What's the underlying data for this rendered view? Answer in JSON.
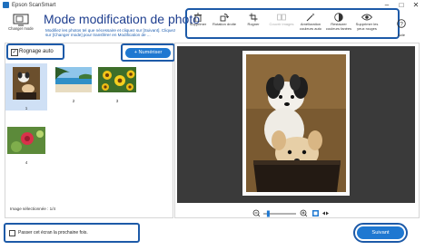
{
  "app": {
    "title": "Epson ScanSmart",
    "accent": "#1f78d1",
    "highlight": "#1d5aa8"
  },
  "header": {
    "changer_mode": "Changer mode",
    "title": "Mode modification de photo",
    "description": "Modifiez les photos tel que nécessaire et cliquez sur [Suivant]. Cliquez sur [Changer mode] pour transférer en Modification de ..."
  },
  "toolbar": {
    "items": [
      {
        "label": "Supprimer",
        "icon": "trash-icon",
        "enabled": true
      },
      {
        "label": "Rotation droite",
        "icon": "rotate-right-icon",
        "enabled": true
      },
      {
        "label": "Rogner",
        "icon": "crop-icon",
        "enabled": true
      },
      {
        "label": "Couvrir images",
        "icon": "cover-images-icon",
        "enabled": false
      },
      {
        "label": "Amélioration couleurs auto",
        "icon": "magic-wand-icon",
        "enabled": true
      },
      {
        "label": "Restaurer couleurs fanées",
        "icon": "restore-colors-icon",
        "enabled": true
      },
      {
        "label": "Supprimer les yeux rouges",
        "icon": "eye-icon",
        "enabled": true
      }
    ],
    "help_label": "Aide"
  },
  "left": {
    "rognage_label": "Rognage auto",
    "rognage_checked": true,
    "numeriser_label": "+ Numériser",
    "thumbnails": [
      {
        "number": "1",
        "selected": true,
        "subject": "dogs"
      },
      {
        "number": "2",
        "selected": false,
        "subject": "beach"
      },
      {
        "number": "3",
        "selected": false,
        "subject": "yellow flowers"
      },
      {
        "number": "4",
        "selected": false,
        "subject": "red flower"
      }
    ],
    "status": "Image sélectionnée : 1/4"
  },
  "viewer": {
    "zoom_level_fraction": 0.15
  },
  "footer": {
    "skip_label": "Passer cet écran la prochaine fois.",
    "skip_checked": false,
    "next_label": "Suivant"
  }
}
